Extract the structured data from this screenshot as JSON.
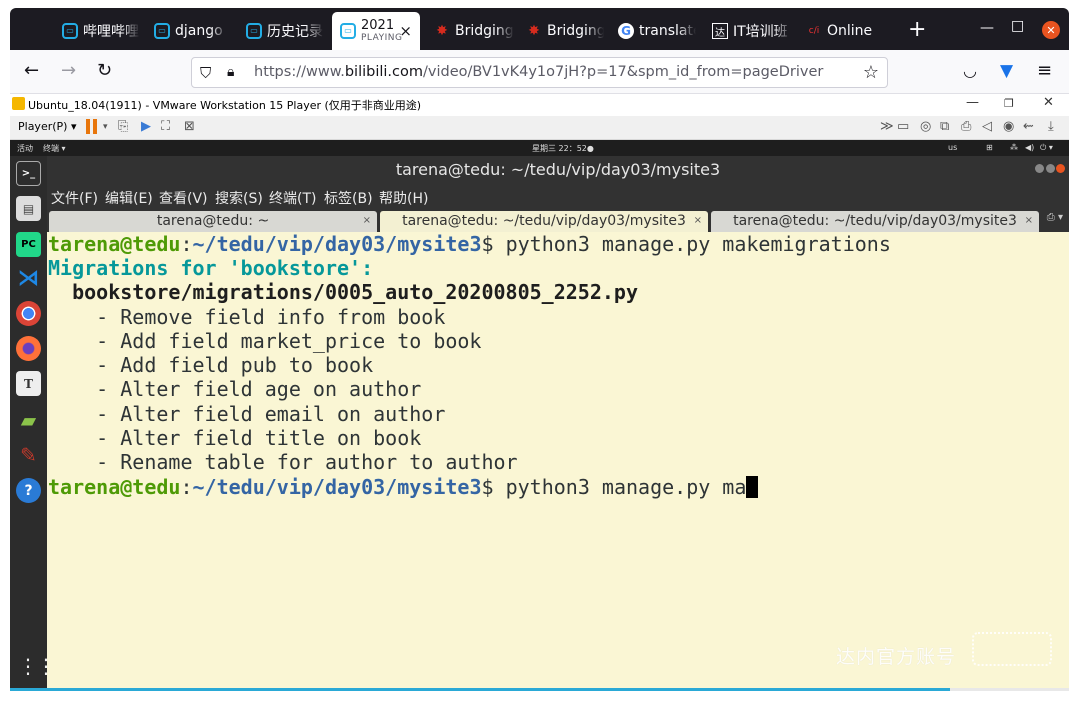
{
  "browser": {
    "tabs": [
      {
        "label": "哔哩哔哩",
        "icon": "bilibili-icon"
      },
      {
        "label": "django",
        "icon": "bilibili-icon"
      },
      {
        "label": "历史记录",
        "icon": "bilibili-icon"
      },
      {
        "label": "2021",
        "sublabel": "PLAYING",
        "icon": "bilibili-icon",
        "close": "×"
      },
      {
        "label": "Bridging",
        "icon": "maple-leaf-icon"
      },
      {
        "label": "Bridging",
        "icon": "maple-leaf-icon"
      },
      {
        "label": "translate",
        "icon": "google-icon"
      },
      {
        "label": "IT培训班",
        "icon": "tedu-icon"
      },
      {
        "label": "Online",
        "icon": "c-logo-icon"
      }
    ],
    "new_tab": "+",
    "url_host_prefix": "https://www.",
    "url_host": "bilibili.com",
    "url_path": "/video/BV1vK4y1o7jH?p=17&spm_id_from=pageDriver"
  },
  "vmware": {
    "title": "Ubuntu_18.04(1911) - VMware Workstation 15 Player (仅用于非商业用途)",
    "player_menu": "Player(P) ▾"
  },
  "ubuntu": {
    "activities": "活动",
    "app_menu": "终端 ▾",
    "clock": "星期三 22：52●",
    "tray_input": "us"
  },
  "terminal": {
    "window_title": "tarena@tedu: ~/tedu/vip/day03/mysite3",
    "menu": [
      "文件(F)",
      "编辑(E)",
      "查看(V)",
      "搜索(S)",
      "终端(T)",
      "标签(B)",
      "帮助(H)"
    ],
    "tabs": [
      {
        "label": "tarena@tedu: ~"
      },
      {
        "label": "tarena@tedu: ~/tedu/vip/day03/mysite3"
      },
      {
        "label": "tarena@tedu: ~/tedu/vip/day03/mysite3"
      }
    ],
    "prompt_user": "tarena@tedu",
    "prompt_path": "~/tedu/vip/day03/mysite3",
    "cmd1": " python3 manage.py makemigrations",
    "migrations_header": "Migrations for 'bookstore':",
    "migration_file": "  bookstore/migrations/0005_auto_20200805_2252.py",
    "ops": [
      "    - Remove field info from book",
      "    - Add field market_price to book",
      "    - Add field pub to book",
      "    - Alter field age on author",
      "    - Alter field email on author",
      "    - Alter field title on book",
      "    - Rename table for author to author"
    ],
    "cmd2": " python3 manage.py ma",
    "watermark": "达内官方账号"
  }
}
